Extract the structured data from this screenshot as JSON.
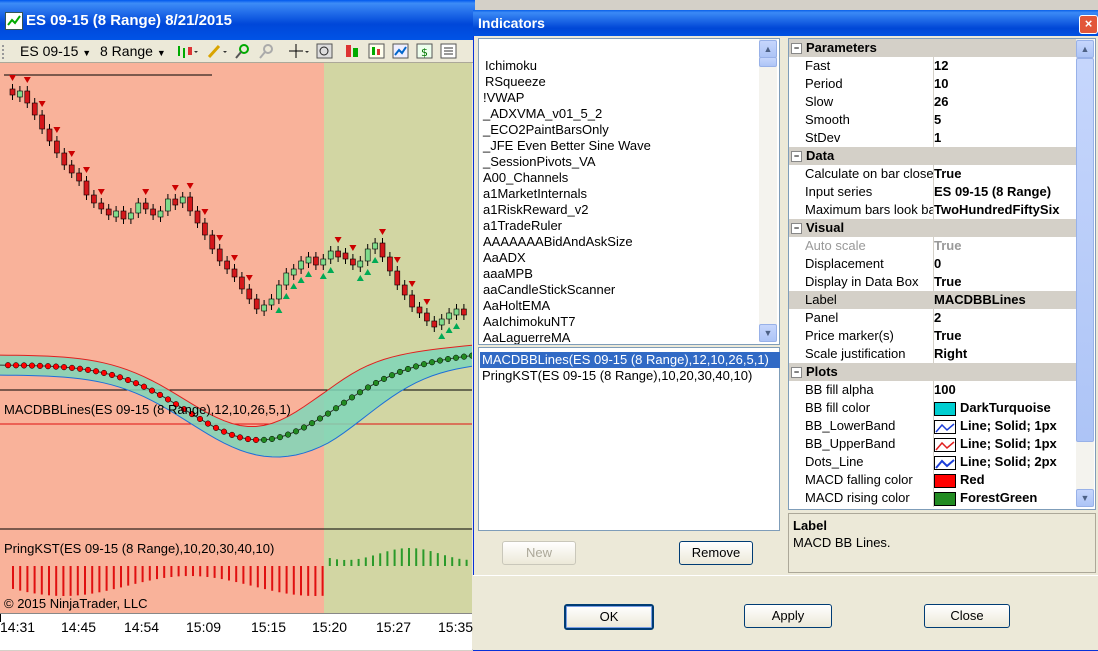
{
  "chart_window": {
    "title": "ES 09-15 (8 Range)  8/21/2015",
    "instrument": "ES 09-15",
    "interval": "8 Range",
    "panel2_label": "MACDBBLines(ES 09-15 (8 Range),12,10,26,5,1)",
    "panel3_label": "PringKST(ES 09-15 (8 Range),10,20,30,40,10)",
    "copyright": "© 2015 NinjaTrader, LLC",
    "x_ticks": [
      "14:31",
      "14:45",
      "14:54",
      "15:09",
      "15:15",
      "15:20",
      "15:27",
      "15:35"
    ]
  },
  "dialog": {
    "title": "Indicators",
    "close": "×",
    "indicator_list": [
      "Ichimoku",
      "RSqueeze",
      "!VWAP",
      "_ADXVMA_v01_5_2",
      "_ECO2PaintBarsOnly",
      "_JFE Even Better Sine Wave",
      "_SessionPivots_VA",
      "A00_Channels",
      "a1MarketInternals",
      "a1RiskReward_v2",
      "a1TradeRuler",
      "AAAAAAABidAndAskSize",
      "AaADX",
      "aaaMPB",
      "aaCandleStickScanner",
      "AaHoltEMA",
      "AaIchimokuNT7",
      "AaLaguerreMA"
    ],
    "applied": [
      "MACDBBLines(ES 09-15 (8 Range),12,10,26,5,1)",
      "PringKST(ES 09-15 (8 Range),10,20,30,40,10)"
    ],
    "new_label": "New",
    "remove_label": "Remove",
    "ok_label": "OK",
    "apply_label": "Apply",
    "close_label": "Close",
    "properties": {
      "parameters": {
        "title": "Parameters",
        "rows": [
          {
            "name": "Fast",
            "value": "12"
          },
          {
            "name": "Period",
            "value": "10"
          },
          {
            "name": "Slow",
            "value": "26"
          },
          {
            "name": "Smooth",
            "value": "5"
          },
          {
            "name": "StDev",
            "value": "1"
          }
        ]
      },
      "data": {
        "title": "Data",
        "rows": [
          {
            "name": "Calculate on bar close",
            "value": "True"
          },
          {
            "name": "Input series",
            "value": "ES 09-15 (8 Range)"
          },
          {
            "name": "Maximum bars look back",
            "value": "TwoHundredFiftySix"
          }
        ]
      },
      "visual": {
        "title": "Visual",
        "rows": [
          {
            "name": "Auto scale",
            "value": "True"
          },
          {
            "name": "Displacement",
            "value": "0"
          },
          {
            "name": "Display in Data Box",
            "value": "True"
          },
          {
            "name": "Label",
            "value": "MACDBBLines"
          },
          {
            "name": "Panel",
            "value": "2"
          },
          {
            "name": "Price marker(s)",
            "value": "True"
          },
          {
            "name": "Scale justification",
            "value": "Right"
          }
        ]
      },
      "plots": {
        "title": "Plots",
        "rows": [
          {
            "name": "BB fill alpha",
            "value": "100"
          },
          {
            "name": "BB fill color",
            "value": "DarkTurquoise",
            "swatch": "#00ced1"
          },
          {
            "name": "BB_LowerBand",
            "value": "Line; Solid; 1px",
            "line": "#1d3fd8"
          },
          {
            "name": "BB_UpperBand",
            "value": "Line; Solid; 1px",
            "line": "#e02020"
          },
          {
            "name": "Dots_Line",
            "value": "Line; Solid; 2px",
            "line": "#1d3fd8"
          },
          {
            "name": "MACD falling color",
            "value": "Red",
            "swatch": "#ff0000"
          },
          {
            "name": "MACD rising color",
            "value": "ForestGreen",
            "swatch": "#228b22"
          }
        ]
      }
    },
    "description": {
      "title": "Label",
      "text": "MACD BB Lines."
    }
  },
  "colors": {
    "session_a": "#f9b29a",
    "session_b": "#d2d6a3",
    "up_candle": "#7fdc8c",
    "down_candle": "#d4171b",
    "selection": "#316ac5"
  }
}
